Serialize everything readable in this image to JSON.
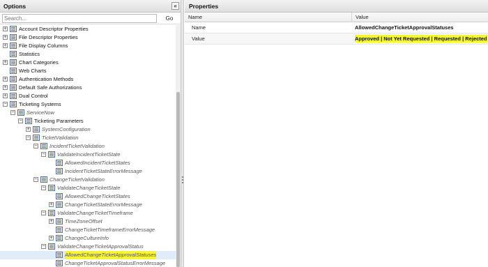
{
  "left_panel": {
    "title": "Options",
    "collapse_glyph": "«",
    "search_placeholder": "Search...",
    "go_label": "Go"
  },
  "tree": [
    {
      "label": "Account Descriptor Properties",
      "toggle": "+",
      "italic": false
    },
    {
      "label": "File Descriptor Properties",
      "toggle": "+",
      "italic": false
    },
    {
      "label": "File Display Columns",
      "toggle": "+",
      "italic": false
    },
    {
      "label": "Statistics",
      "toggle": "",
      "italic": false
    },
    {
      "label": "Chart Categories",
      "toggle": "+",
      "italic": false
    },
    {
      "label": "Web Charts",
      "toggle": "",
      "italic": false
    },
    {
      "label": "Authentication Methods",
      "toggle": "+",
      "italic": false
    },
    {
      "label": "Default Safe Authorizations",
      "toggle": "+",
      "italic": false
    },
    {
      "label": "Dual Control",
      "toggle": "+",
      "italic": false
    },
    {
      "label": "Ticketing Systems",
      "toggle": "−",
      "italic": false
    },
    {
      "label": "ServiceNow",
      "toggle": "−",
      "italic": true
    },
    {
      "label": "Ticketing Parameters",
      "toggle": "−",
      "italic": false
    },
    {
      "label": "SystemConfiguration",
      "toggle": "+",
      "italic": true
    },
    {
      "label": "TicketValidation",
      "toggle": "−",
      "italic": true
    },
    {
      "label": "IncidentTicketValidation",
      "toggle": "−",
      "italic": true
    },
    {
      "label": "ValidateIncidentTicketState",
      "toggle": "−",
      "italic": true
    },
    {
      "label": "AllowedIncidentTicketStates",
      "toggle": "",
      "italic": true
    },
    {
      "label": "IncidentTicketStateErrorMessage",
      "toggle": "",
      "italic": true
    },
    {
      "label": "ChangeTicketValidation",
      "toggle": "−",
      "italic": true
    },
    {
      "label": "ValidateChangeTicketState",
      "toggle": "−",
      "italic": true
    },
    {
      "label": "AllowedChangeTicketStates",
      "toggle": "",
      "italic": true
    },
    {
      "label": "ChangeTicketStateErrorMessage",
      "toggle": "+",
      "italic": true
    },
    {
      "label": "ValidateChangeTicketTimeframe",
      "toggle": "−",
      "italic": true
    },
    {
      "label": "TimeZoneOffset",
      "toggle": "+",
      "italic": true
    },
    {
      "label": "ChangeTicketTimeframeErrorMessage",
      "toggle": "",
      "italic": true
    },
    {
      "label": "ChangeCultureInfo",
      "toggle": "+",
      "italic": true
    },
    {
      "label": "ValidateChangeTicketApprovalStatus",
      "toggle": "−",
      "italic": true
    },
    {
      "label": "AllowedChangeTicketApprovalStatuses",
      "toggle": "",
      "italic": true
    },
    {
      "label": "ChangeTicketApprovalStatusErrorMessage",
      "toggle": "",
      "italic": true
    }
  ],
  "right_panel": {
    "title": "Properties",
    "col_name": "Name",
    "col_value": "Value",
    "rows": [
      {
        "name": "Name",
        "value": "AllowedChangeTicketApprovalStatuses"
      },
      {
        "name": "Value",
        "value": "Approved | Not Yet Requested | Requested | Rejected"
      }
    ]
  },
  "colors": {
    "highlight": "#f7f53a",
    "selected_row": "#e0ecfa",
    "icon_border": "#4a6fa5"
  }
}
